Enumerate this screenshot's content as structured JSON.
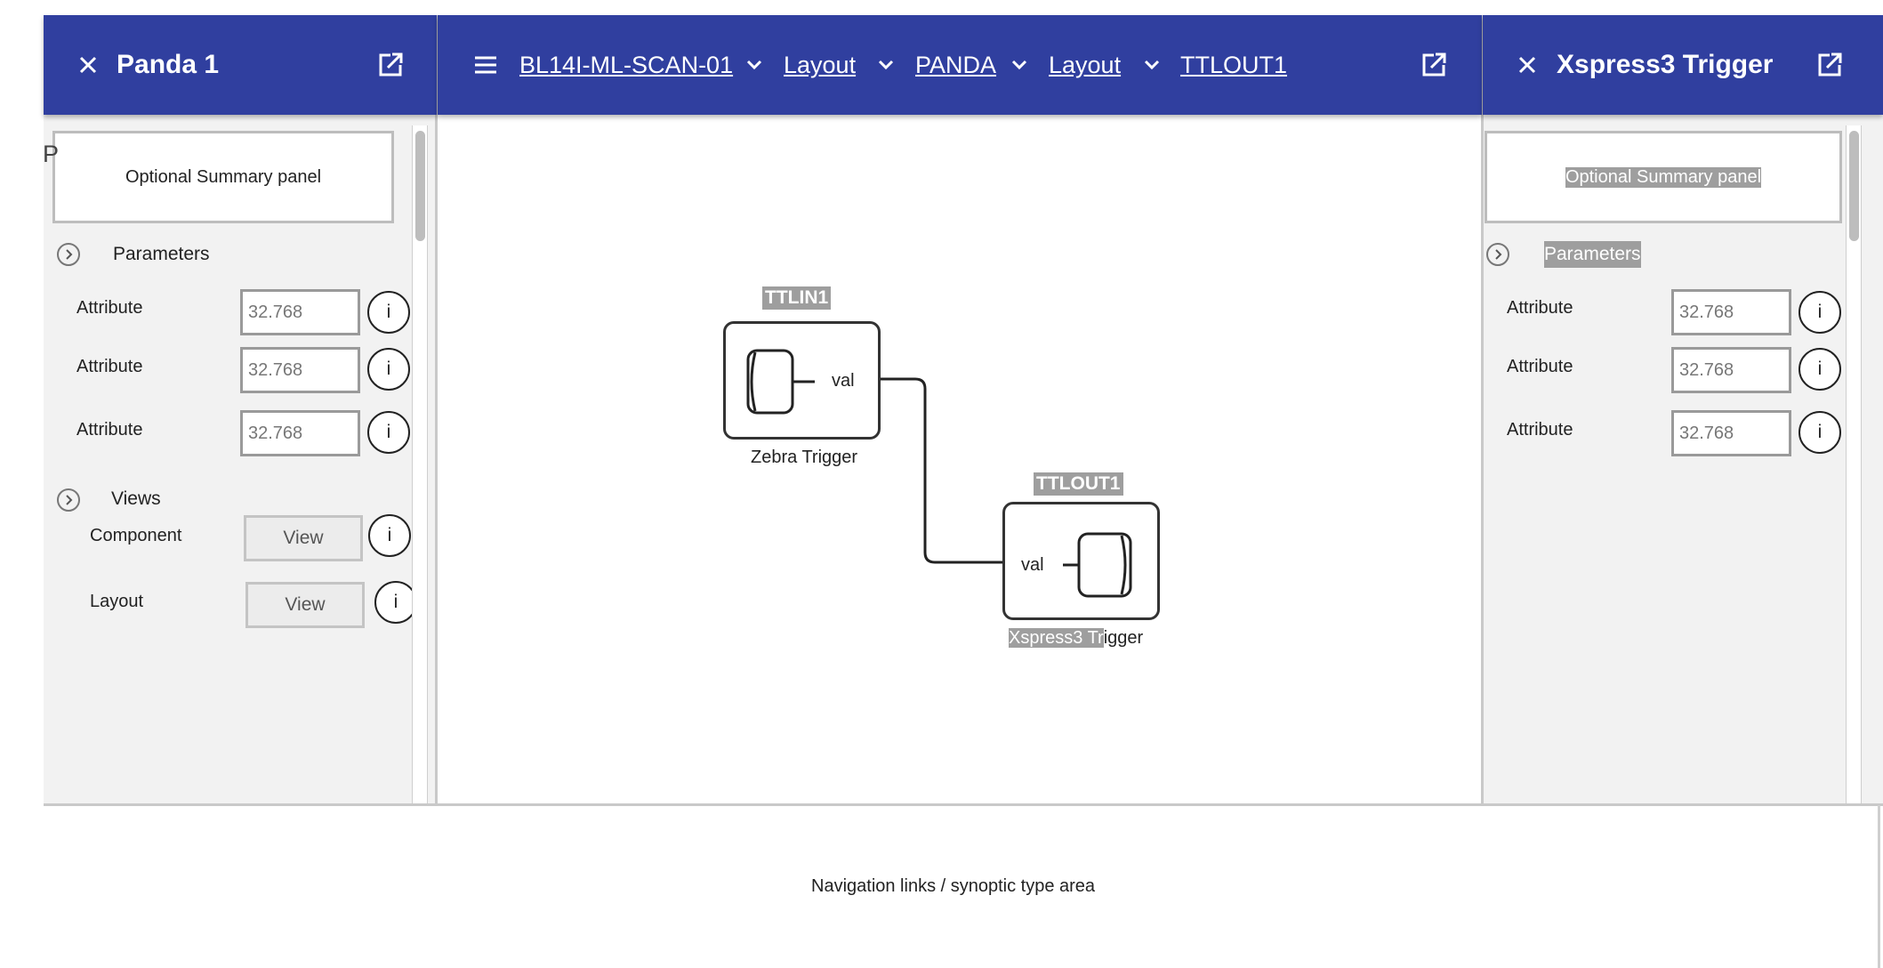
{
  "left_panel": {
    "title": "Panda 1",
    "stray_char": "P",
    "summary": "Optional Summary panel",
    "parameters_label": "Parameters",
    "attributes": [
      {
        "label": "Attribute",
        "value": "32.768"
      },
      {
        "label": "Attribute",
        "value": "32.768"
      },
      {
        "label": "Attribute",
        "value": "32.768"
      }
    ],
    "views_label": "Views",
    "views": [
      {
        "label": "Component",
        "button": "View"
      },
      {
        "label": "Layout",
        "button": "View"
      }
    ],
    "info_glyph": "i"
  },
  "center": {
    "breadcrumbs": [
      "BL14I-ML-SCAN-01",
      "Layout",
      "PANDA",
      "Layout",
      "TTLOUT1"
    ],
    "blocks": [
      {
        "title": "TTLIN1",
        "label": "Zebra Trigger",
        "port": "val"
      },
      {
        "title": "TTLOUT1",
        "label_highlight": "Xspress3 Tr",
        "label_rest": "igger",
        "port": "val"
      }
    ]
  },
  "right_panel": {
    "title": "Xspress3 Trigger",
    "summary": "Optional Summary panel",
    "parameters_label": "Parameters",
    "attributes": [
      {
        "label": "Attribute",
        "value": "32.768"
      },
      {
        "label": "Attribute",
        "value": "32.768"
      },
      {
        "label": "Attribute",
        "value": "32.768"
      }
    ],
    "info_glyph": "i"
  },
  "footer": {
    "text": "Navigation links / synoptic type area"
  },
  "icons": {
    "close": "close-icon",
    "popout": "open-in-new-icon",
    "menu": "menu-icon",
    "chevron": "chevron-down-icon",
    "expand": "chevron-right-circle-icon",
    "info": "info-icon",
    "port": "cylinder-port-icon"
  },
  "colors": {
    "header": "#303f9f",
    "panel_bg": "#f2f2f2",
    "highlight": "#9e9e9e"
  }
}
